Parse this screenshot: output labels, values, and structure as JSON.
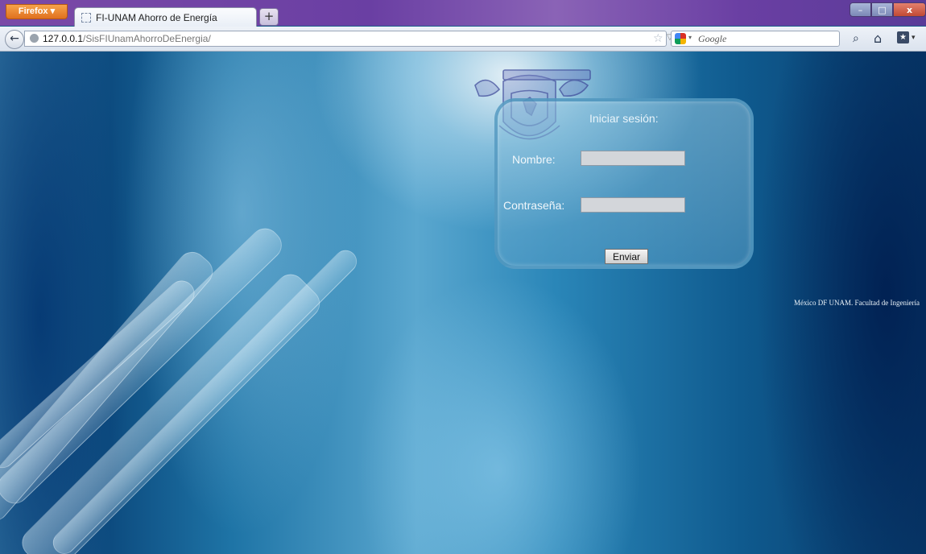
{
  "browser": {
    "menu_button": "Firefox",
    "tab_title": "FI-UNAM Ahorro de Energía",
    "new_tab_label": "+",
    "url_host": "127.0.0.1",
    "url_path": "/SisFIUnamAhorroDeEnergia/",
    "search_placeholder": "Google",
    "window_controls": {
      "minimize": "–",
      "maximize": "□",
      "close": "x"
    }
  },
  "login": {
    "title": "Iniciar sesión:",
    "name_label": "Nombre:",
    "password_label": "Contraseña:",
    "name_value": "",
    "password_value": "",
    "submit_label": "Enviar"
  },
  "footer": {
    "text": "México DF UNAM. Facultad de Ingeniería"
  },
  "icons": [
    "back-arrow-icon",
    "globe-icon",
    "star-icon",
    "reload-icon",
    "google-icon",
    "search-icon",
    "home-icon",
    "bookmarks-icon",
    "unam-seal-icon"
  ]
}
